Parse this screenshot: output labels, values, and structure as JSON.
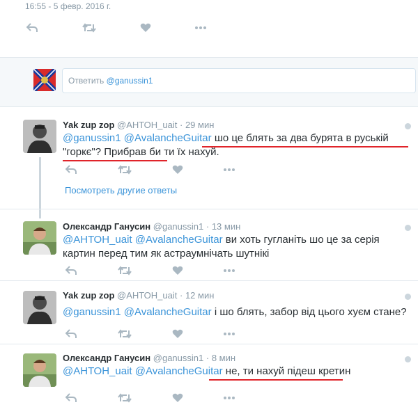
{
  "timestamp": "16:55 - 5 февр. 2016 г.",
  "colors": {
    "accent": "#3b94d9",
    "underline": "#e0242a",
    "icon": "#aab8c2"
  },
  "reply": {
    "placeholder_prefix": "Ответить",
    "mention": "@ganussin1"
  },
  "show_more": "Посмотреть другие ответы",
  "tweets": [
    {
      "name": "Yak zup zop",
      "handle": "@АНТОН_uait",
      "dot": "·",
      "time": "29 мин",
      "mentions": "@ganussin1 @AvalancheGuitar",
      "text": "шо це блять за два бурята в руськiй \"горкє\"? Прибрав би ти їх нахуй."
    },
    {
      "name": "Олександр Ганусин",
      "handle": "@ganussin1",
      "dot": "·",
      "time": "13 мин",
      "mentions": "@АНТОН_uait @AvalancheGuitar",
      "text": "ви хоть гуглaнiть шо це за серія картин перед тим як астраумнiчать шутнiкi"
    },
    {
      "name": "Yak zup zop",
      "handle": "@АНТОН_uait",
      "dot": "·",
      "time": "12 мин",
      "mentions": "@ganussin1 @AvalancheGuitar",
      "text": "i шо блять, забор вiд цього хуєм стане?"
    },
    {
      "name": "Олександр Ганусин",
      "handle": "@ganussin1",
      "dot": "·",
      "time": "8 мин",
      "mentions": "@АНТОН_uait @AvalancheGuitar",
      "text": "не, ти нахуй пiдеш кретин"
    }
  ]
}
